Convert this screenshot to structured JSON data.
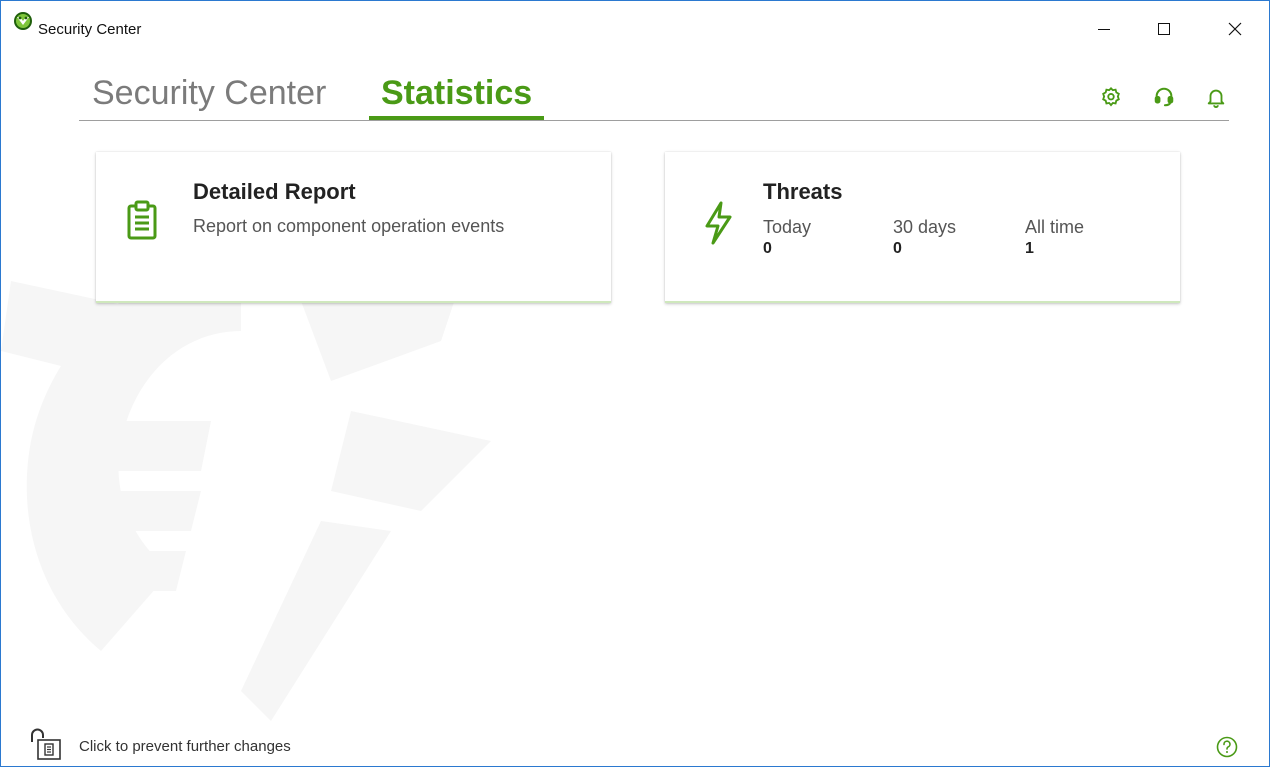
{
  "window": {
    "title": "Security Center",
    "accent_color": "#4a9a16"
  },
  "titlebar_controls": {
    "minimize_icon": "minimize-icon",
    "maximize_icon": "maximize-icon",
    "close_icon": "close-icon"
  },
  "tabs": [
    {
      "label": "Security Center",
      "active": false
    },
    {
      "label": "Statistics",
      "active": true
    }
  ],
  "top_icons": [
    "gear-icon",
    "headset-icon",
    "bell-icon"
  ],
  "cards": {
    "report": {
      "title": "Detailed Report",
      "subtitle": "Report on component operation events",
      "icon": "clipboard-icon"
    },
    "threats": {
      "title": "Threats",
      "icon": "lightning-icon",
      "stats": [
        {
          "label": "Today",
          "value": "0"
        },
        {
          "label": "30 days",
          "value": "0"
        },
        {
          "label": "All time",
          "value": "1"
        }
      ]
    }
  },
  "footer": {
    "lock_text": "Click to prevent further changes",
    "lock_icon": "padlock-open-icon",
    "help_icon": "help-icon"
  }
}
